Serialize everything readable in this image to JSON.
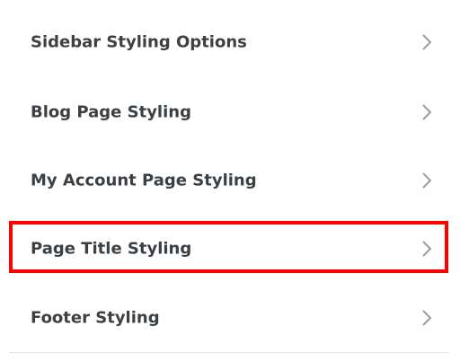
{
  "menu": {
    "items": [
      {
        "label": "Sidebar Styling Options",
        "icon": "chevron-right-icon"
      },
      {
        "label": "Blog Page Styling",
        "icon": "chevron-right-icon"
      },
      {
        "label": "My Account Page Styling",
        "icon": "chevron-right-icon"
      },
      {
        "label": "Page Title Styling",
        "icon": "chevron-right-icon",
        "highlighted": true
      },
      {
        "label": "Footer Styling",
        "icon": "chevron-right-icon"
      }
    ]
  },
  "colors": {
    "text": "#3b4045",
    "chevron": "#9a9fa4",
    "divider": "#e6e6e6",
    "highlight": "#ff0000",
    "background": "#ffffff"
  }
}
